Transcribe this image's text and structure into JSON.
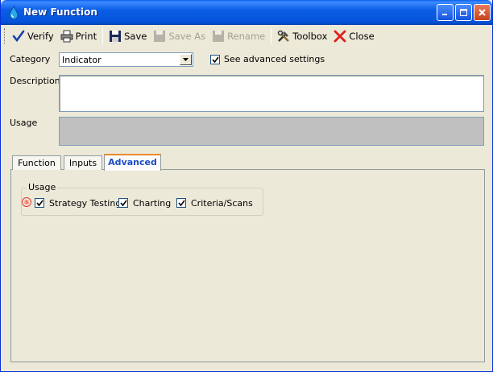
{
  "window": {
    "title": "New Function",
    "controls": [
      "minimize",
      "maximize",
      "close"
    ]
  },
  "toolbar": {
    "items": [
      {
        "label": "Verify",
        "icon": "checkmark-icon",
        "enabled": true
      },
      {
        "label": "Print",
        "icon": "printer-icon",
        "enabled": true
      },
      {
        "label": "Save",
        "icon": "floppy-icon",
        "enabled": true
      },
      {
        "label": "Save As",
        "icon": "floppy-icon",
        "enabled": false
      },
      {
        "label": "Rename",
        "icon": "floppy-icon",
        "enabled": false
      },
      {
        "label": "Toolbox",
        "icon": "tools-icon",
        "enabled": true
      },
      {
        "label": "Close",
        "icon": "red-x-icon",
        "enabled": true
      }
    ]
  },
  "form": {
    "category_label": "Category",
    "category_value": "Indicator",
    "advanced_settings_label": "See advanced settings",
    "advanced_settings_checked": true,
    "description_label": "Description",
    "description_value": "",
    "usage_label": "Usage"
  },
  "tabs": [
    {
      "label": "Function",
      "active": false
    },
    {
      "label": "Inputs",
      "active": false
    },
    {
      "label": "Advanced",
      "active": true
    }
  ],
  "advanced": {
    "group_title": "Usage",
    "marker": "⑤",
    "options": [
      {
        "label": "Strategy Testing",
        "checked": true
      },
      {
        "label": "Charting",
        "checked": true
      },
      {
        "label": "Criteria/Scans",
        "checked": true
      }
    ]
  },
  "colors": {
    "titlebar": "#0553d9",
    "active_tab_text": "#1b4cc6",
    "marker": "#e8342a"
  }
}
